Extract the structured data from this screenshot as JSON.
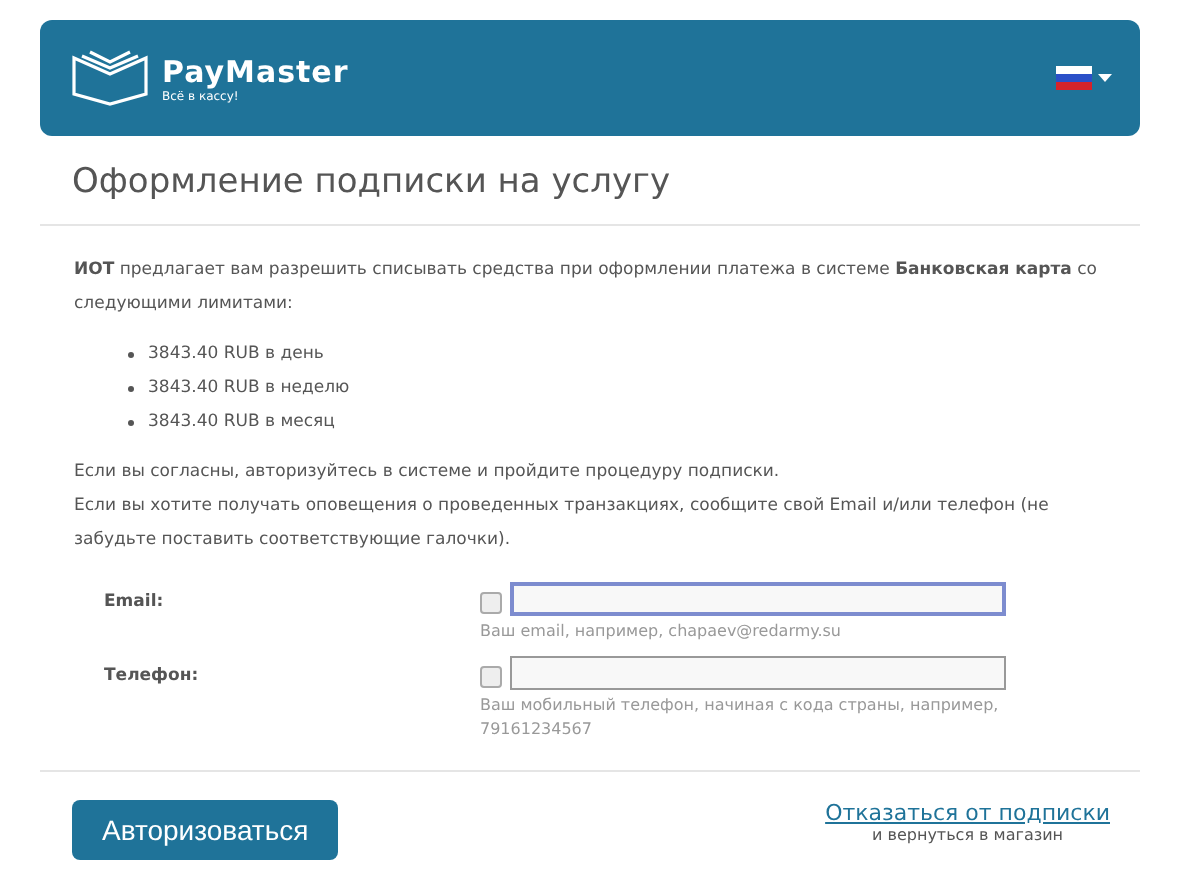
{
  "header": {
    "brand": "PayMaster",
    "tagline": "Всё в кассу!"
  },
  "title": "Оформление подписки на услугу",
  "intro": "**ИОТ** предлагает вам разрешить списывать средства при оформлении платежа в системе **Банковская карта** со следующими лимитами:",
  "limits": [
    "3843.40 RUB в день",
    "3843.40 RUB в неделю",
    "3843.40 RUB в месяц"
  ],
  "notes": [
    "Если вы согласны, авторизуйтесь в системе и пройдите процедуру подписки.",
    "Если вы хотите получать оповещения о проведенных транзакциях, сообщите свой Email и/или телефон (не забудьте поставить соответствующие галочки)."
  ],
  "fields": [
    {
      "label": "Email:",
      "checked": false,
      "focused": true,
      "hint": "Ваш email, например, chapaev@redarmy.su"
    },
    {
      "label": "Телефон:",
      "checked": false,
      "focused": false,
      "hint": "Ваш мобильный телефон, начиная с кода страны, например, 79161234567"
    }
  ],
  "actions": {
    "submit": "Авторизоваться",
    "cancel_link": "Отказаться от подписки",
    "cancel_note": "и вернуться в магазин"
  }
}
